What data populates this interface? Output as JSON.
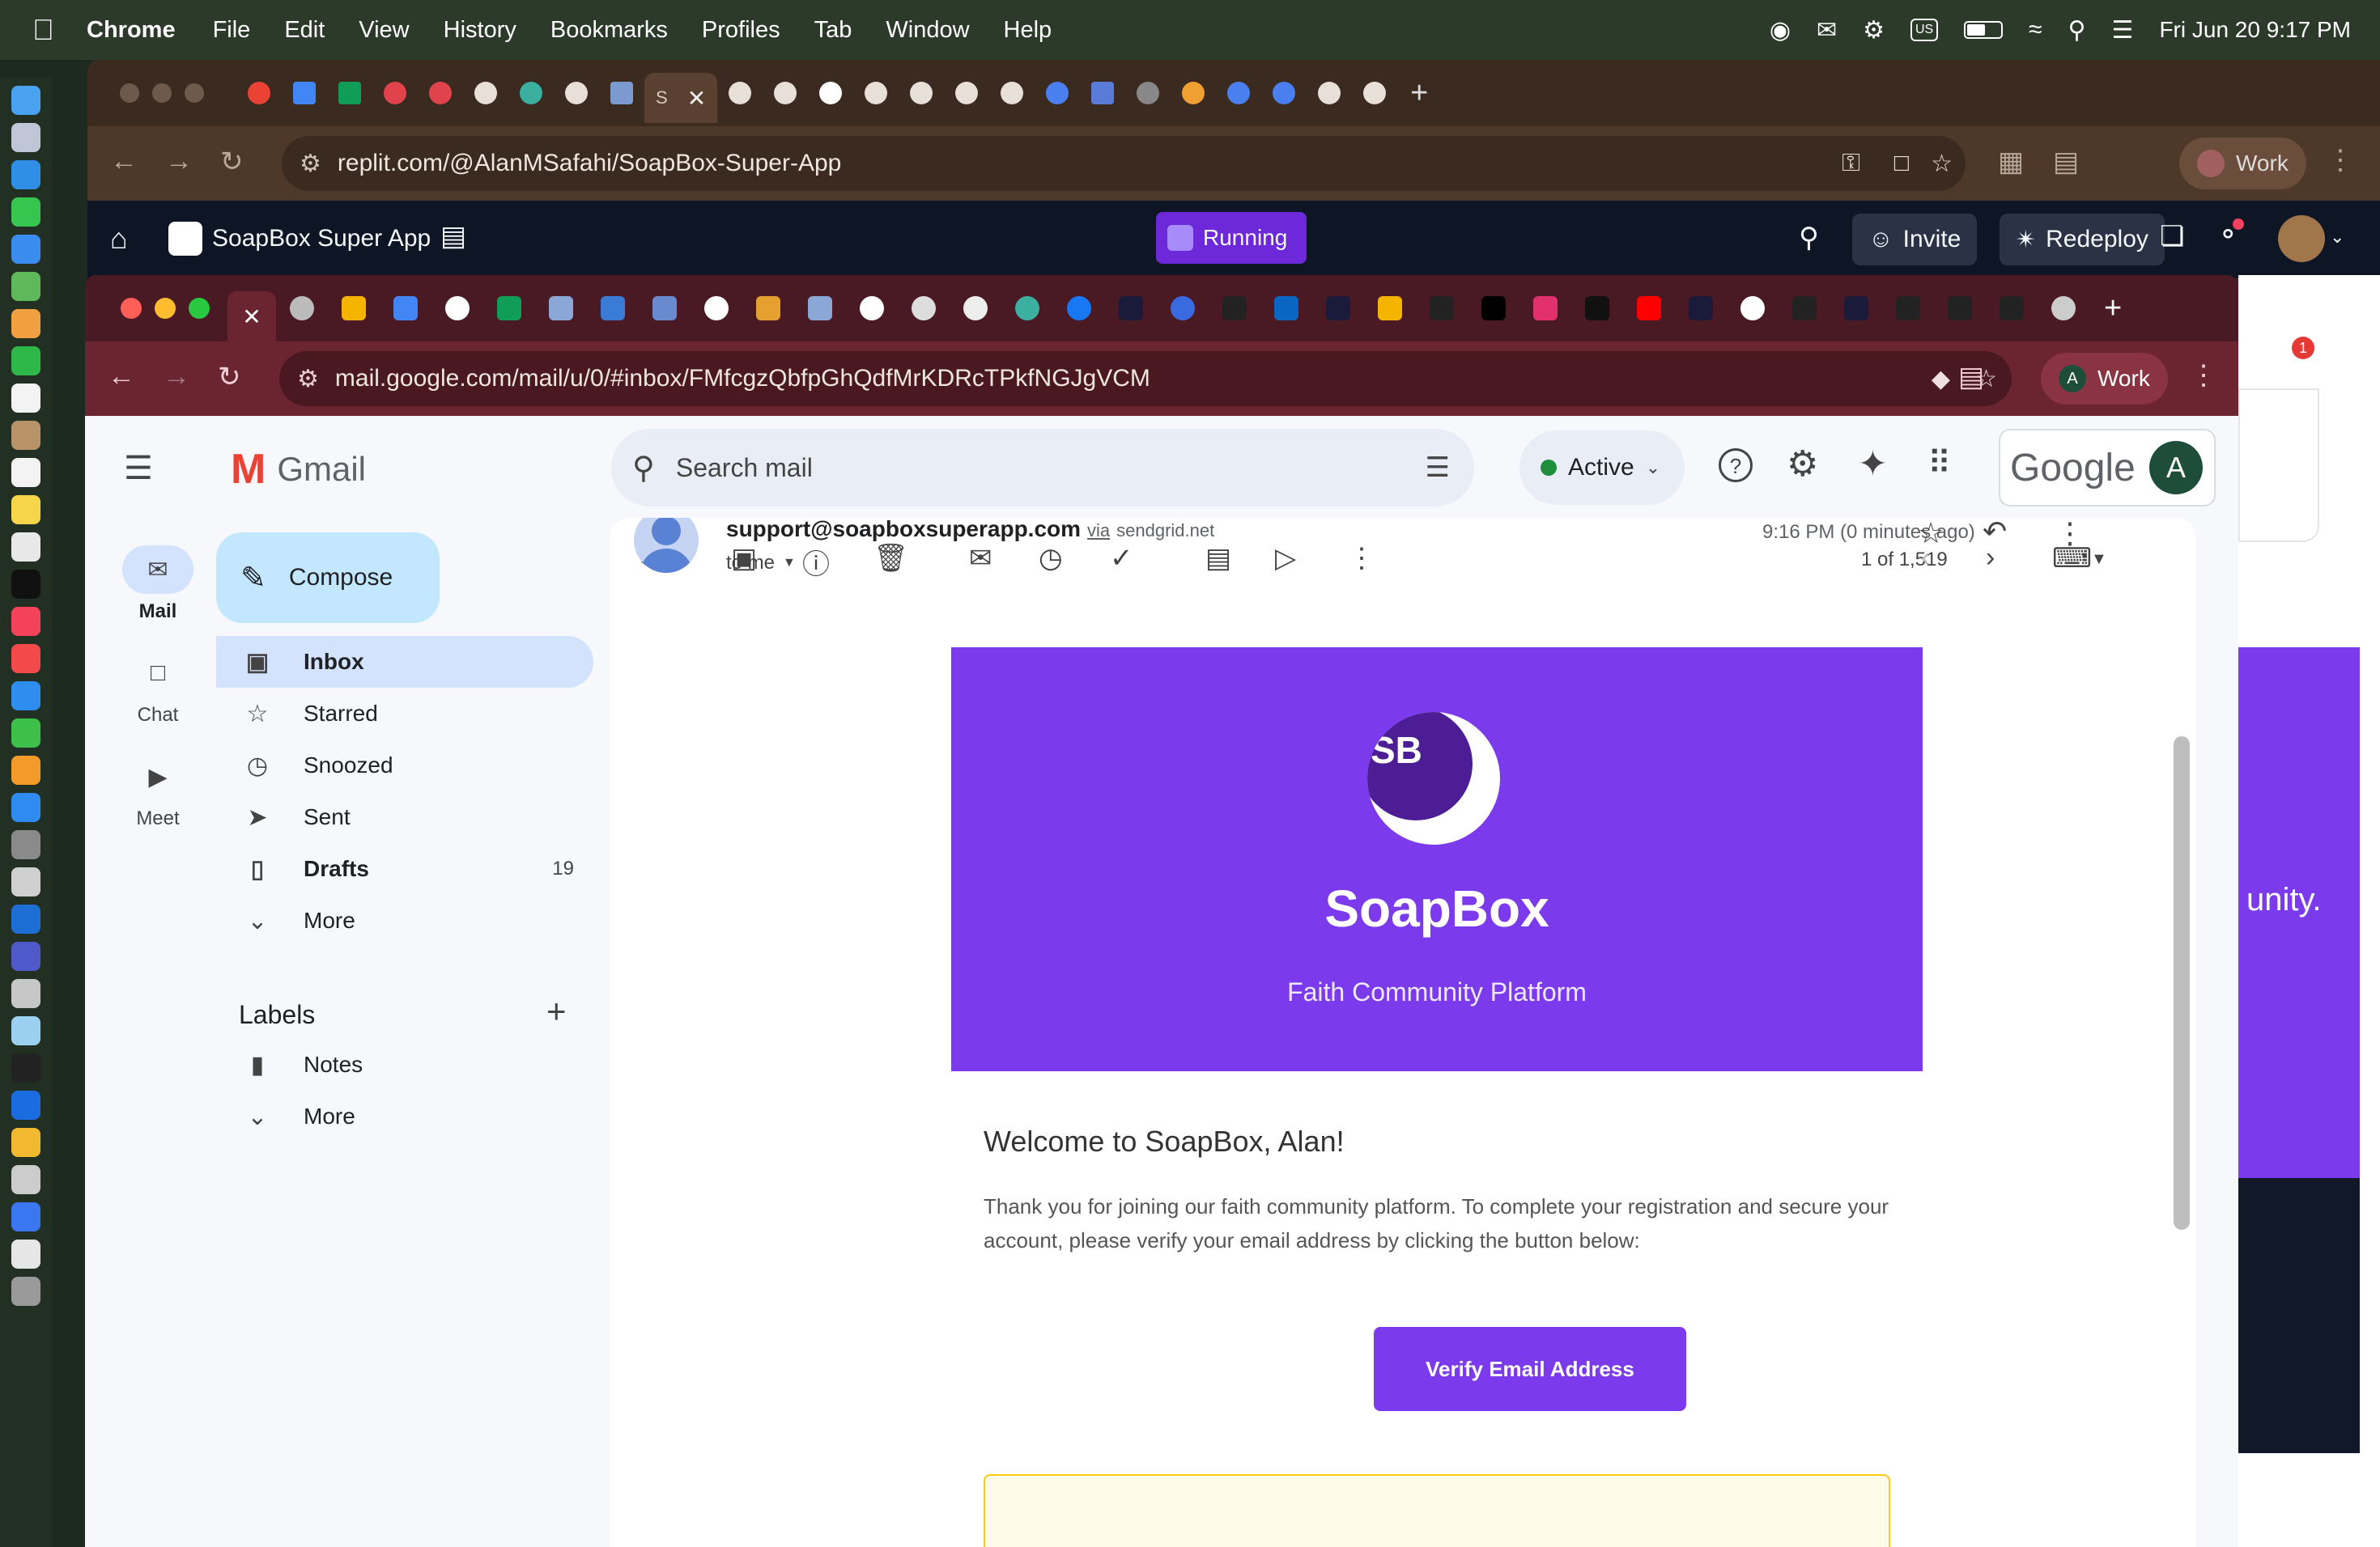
{
  "menubar": {
    "app": "Chrome",
    "items": [
      "File",
      "Edit",
      "View",
      "History",
      "Bookmarks",
      "Profiles",
      "Tab",
      "Window",
      "Help"
    ],
    "input_source": "US",
    "datetime": "Fri Jun 20  9:17 PM"
  },
  "outer_browser": {
    "url": "replit.com/@AlanMSafahi/SoapBox-Super-App",
    "profile": "Work",
    "active_tab_letter": "S",
    "new_tab": "+"
  },
  "replit": {
    "project_name": "SoapBox Super App",
    "status": "Running",
    "invite": "Invite",
    "redeploy": "Redeploy",
    "notifications": "1"
  },
  "inner_browser": {
    "url": "mail.google.com/mail/u/0/#inbox/FMfcgzQbfpGhQdfMrKDRcTPkfNGJgVCM",
    "profile": "Work",
    "profile_initial": "A",
    "new_tab": "+"
  },
  "gmail": {
    "brand": "Gmail",
    "search_placeholder": "Search mail",
    "status": "Active",
    "google": "Google",
    "avatar_initial": "A",
    "compose": "Compose",
    "rail": [
      {
        "label": "Mail"
      },
      {
        "label": "Chat"
      },
      {
        "label": "Meet"
      }
    ],
    "folders": [
      {
        "label": "Inbox",
        "count": ""
      },
      {
        "label": "Starred",
        "count": ""
      },
      {
        "label": "Snoozed",
        "count": ""
      },
      {
        "label": "Sent",
        "count": ""
      },
      {
        "label": "Drafts",
        "count": "19"
      },
      {
        "label": "More",
        "count": ""
      }
    ],
    "labels_heading": "Labels",
    "labels": [
      {
        "label": "Notes"
      },
      {
        "label": "More"
      }
    ],
    "pagination": "1 of 1,519"
  },
  "message": {
    "sender": "support@soapboxsuperapp.com",
    "via": "via",
    "via_domain": "sendgrid.net",
    "time": "9:16 PM (0 minutes ago)",
    "to": "to me",
    "logo_text": "SB",
    "brand": "SoapBox",
    "tagline": "Faith Community Platform",
    "greeting": "Welcome to SoapBox, Alan!",
    "body_line1": "Thank you for joining our faith community platform. To complete your registration and secure your",
    "body_line2": "account, please verify your email address by clicking the button below:",
    "cta": "Verify Email Address"
  },
  "peek": {
    "text": "unity."
  },
  "colors": {
    "brand_purple": "#7c3aed",
    "gmail_active": "#d3e3fd",
    "compose_bg": "#c2e7ff",
    "status_green": "#1e8e3e"
  }
}
